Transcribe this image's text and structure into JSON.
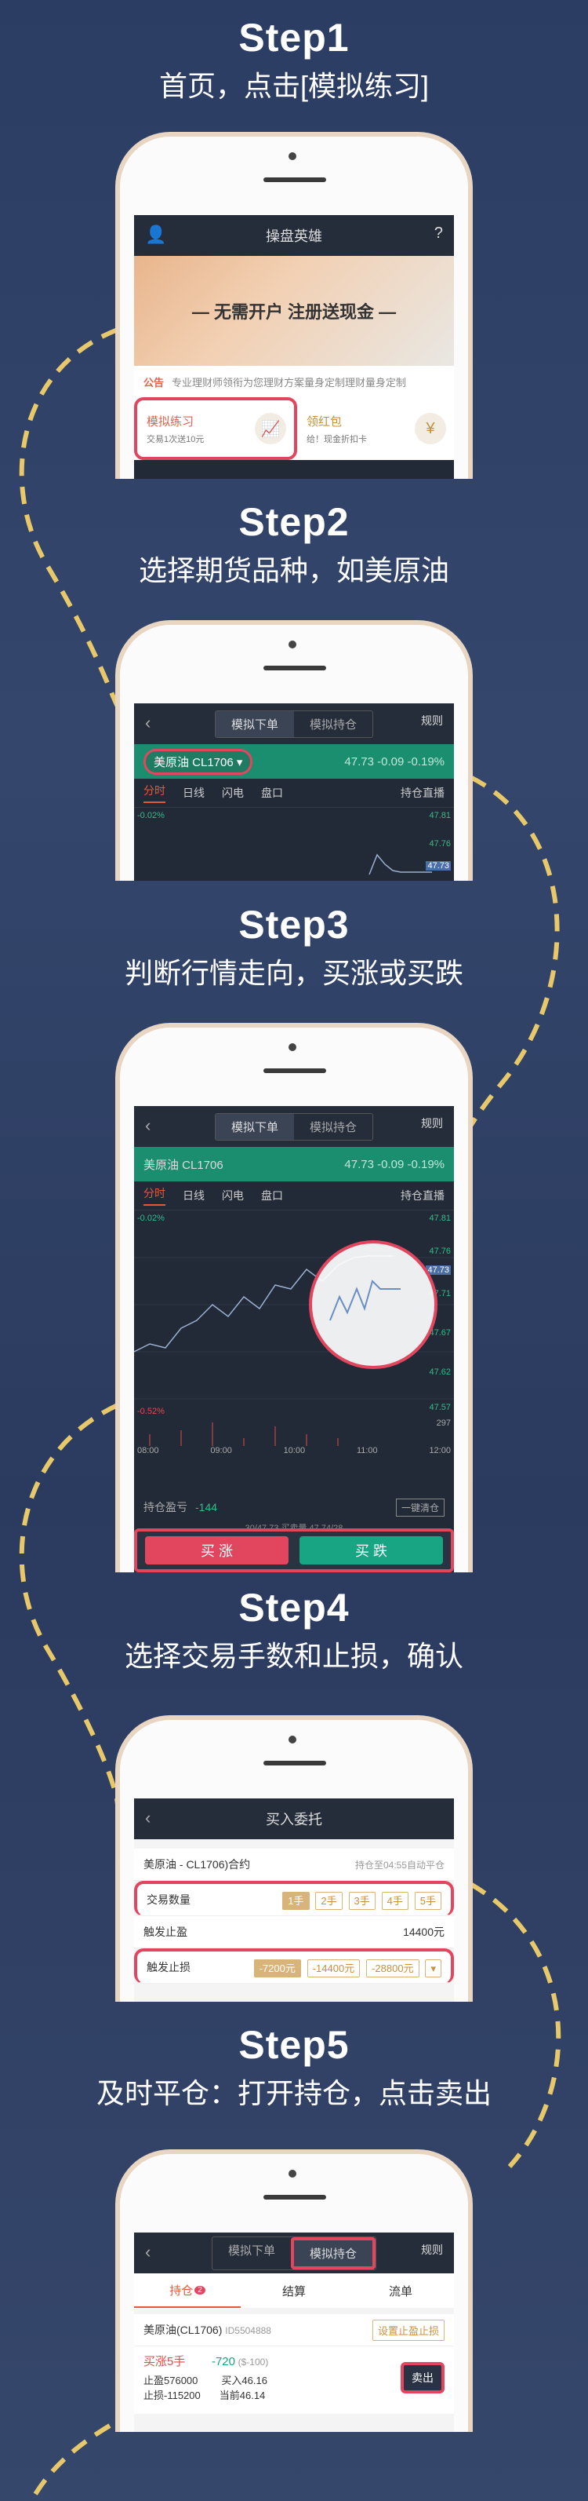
{
  "steps": [
    {
      "title": "Step1",
      "desc": "首页，点击[模拟练习]"
    },
    {
      "title": "Step2",
      "desc": "选择期货品种，如美原油"
    },
    {
      "title": "Step3",
      "desc": "判断行情走向，买涨或买跌"
    },
    {
      "title": "Step4",
      "desc": "选择交易手数和止损，确认"
    },
    {
      "title": "Step5",
      "desc": "及时平仓：打开持仓，点击卖出"
    }
  ],
  "screen1": {
    "title": "操盘英雄",
    "banner": "— 无需开户 注册送现金 —",
    "notice_tag": "公告",
    "notice_text": "专业理财师领衔为您理财方案量身定制理财量身定制",
    "card1_title": "模拟练习",
    "card1_sub": "交易1次送10元",
    "card2_title": "领红包",
    "card2_sub": "给！现金折扣卡"
  },
  "screen2": {
    "tab_order": "模拟下单",
    "tab_position": "模拟持仓",
    "rules": "规则",
    "instrument": "美原油 CL1706 ▾",
    "price": "47.73  -0.09  -0.19%",
    "tabs": [
      "分时",
      "日线",
      "闪电",
      "盘口"
    ],
    "tab_right": "持仓直播",
    "left_pct": "-0.02%",
    "r1": "47.81",
    "r2": "47.76",
    "r3": "47.73"
  },
  "screen3": {
    "tab_order": "模拟下单",
    "tab_position": "模拟持仓",
    "rules": "规则",
    "instrument": "美原油 CL1706",
    "price": "47.73  -0.09  -0.19%",
    "tabs": [
      "分时",
      "日线",
      "闪电",
      "盘口"
    ],
    "tab_right": "持仓直播",
    "left_top": "-0.02%",
    "left_bottom": "-0.52%",
    "right_vals": [
      "47.81",
      "47.76",
      "47.73",
      "47.71",
      "47.67",
      "47.62",
      "47.57",
      "297"
    ],
    "times": [
      "08:00",
      "09:00",
      "10:00",
      "11:00",
      "12:00"
    ],
    "pnl_label": "持仓盈亏",
    "pnl_value": "-144",
    "close_all": "一键清仓",
    "ticker": "30/47.73 买卖量 47.74/28",
    "buy_up": "买 涨",
    "buy_down": "买 跌"
  },
  "screen4": {
    "title": "买入委托",
    "contract": "美原油 - CL1706)合约",
    "auto_close": "持仓至04:55自动平仓",
    "qty_label": "交易数量",
    "qty_opts": [
      "1手",
      "2手",
      "3手",
      "4手",
      "5手"
    ],
    "trigger_label": "触发止盈",
    "trigger_value": "14400元",
    "stop_label": "触发止损",
    "stop_opts": [
      "-7200元",
      "-14400元",
      "-28800元"
    ]
  },
  "screen5": {
    "tab_order": "模拟下单",
    "tab_position": "模拟持仓",
    "rules": "规则",
    "pos_tabs": [
      "持仓",
      "结算",
      "流单"
    ],
    "badge": "2",
    "contract": "美原油(CL1706)",
    "id_text": "ID5504888",
    "set_btn": "设置止盈止损",
    "side": "买涨5手",
    "pnl": "-720",
    "pnl_sub": "($-100)",
    "tp": "止盈576000",
    "sl": "止损-115200",
    "buy_price": "买入46.16",
    "cur_price": "当前46.14",
    "sell": "卖出"
  },
  "colors": {
    "bg": "#2f4066",
    "accent_red": "#e2465f",
    "green": "#1b8e6f",
    "gold": "#d9b47a",
    "dashes": "#e7c86a"
  }
}
